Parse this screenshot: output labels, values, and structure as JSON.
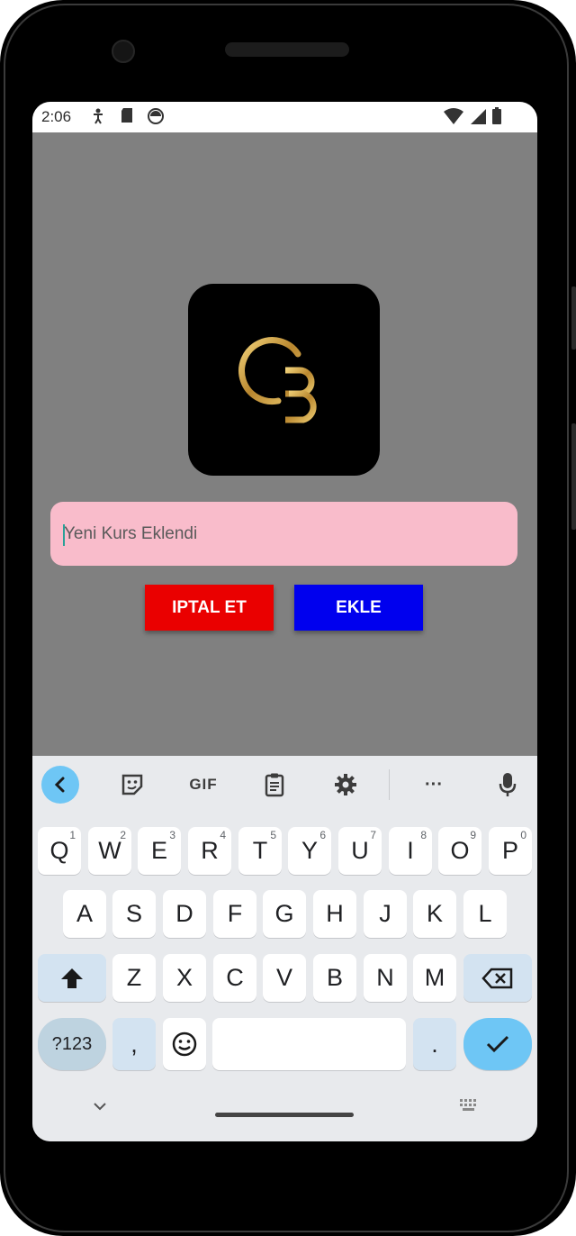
{
  "status_bar": {
    "time": "2:06",
    "icons": [
      "accessibility-icon",
      "sd-card-icon",
      "record-icon",
      "wifi-icon",
      "signal-icon",
      "battery-icon"
    ]
  },
  "app": {
    "background_color": "#808080",
    "logo": {
      "name": "cb-monogram-logo",
      "colors": [
        "#c9a34a",
        "#000000"
      ]
    },
    "course_input": {
      "value": "Yeni Kurs Eklendi",
      "background": "#f9bccb"
    },
    "buttons": {
      "cancel_label": "IPTAL ET",
      "cancel_color": "#ea0000",
      "add_label": "EKLE",
      "add_color": "#0000ee"
    }
  },
  "keyboard": {
    "toolbar": {
      "back_icon": "chevron-left-icon",
      "sticker_icon": "sticker-icon",
      "gif_label": "GIF",
      "clipboard_icon": "clipboard-icon",
      "settings_icon": "gear-icon",
      "more_label": "···",
      "mic_icon": "mic-icon"
    },
    "row1": [
      {
        "k": "Q",
        "h": "1"
      },
      {
        "k": "W",
        "h": "2"
      },
      {
        "k": "E",
        "h": "3"
      },
      {
        "k": "R",
        "h": "4"
      },
      {
        "k": "T",
        "h": "5"
      },
      {
        "k": "Y",
        "h": "6"
      },
      {
        "k": "U",
        "h": "7"
      },
      {
        "k": "I",
        "h": "8"
      },
      {
        "k": "O",
        "h": "9"
      },
      {
        "k": "P",
        "h": "0"
      }
    ],
    "row2": [
      "A",
      "S",
      "D",
      "F",
      "G",
      "H",
      "J",
      "K",
      "L"
    ],
    "row3": [
      "Z",
      "X",
      "C",
      "V",
      "B",
      "N",
      "M"
    ],
    "row4": {
      "symbols_label": "?123",
      "comma": ",",
      "period": "."
    },
    "nav": {
      "hide_icon": "chevron-down-icon",
      "switch_icon": "keyboard-icon"
    }
  }
}
